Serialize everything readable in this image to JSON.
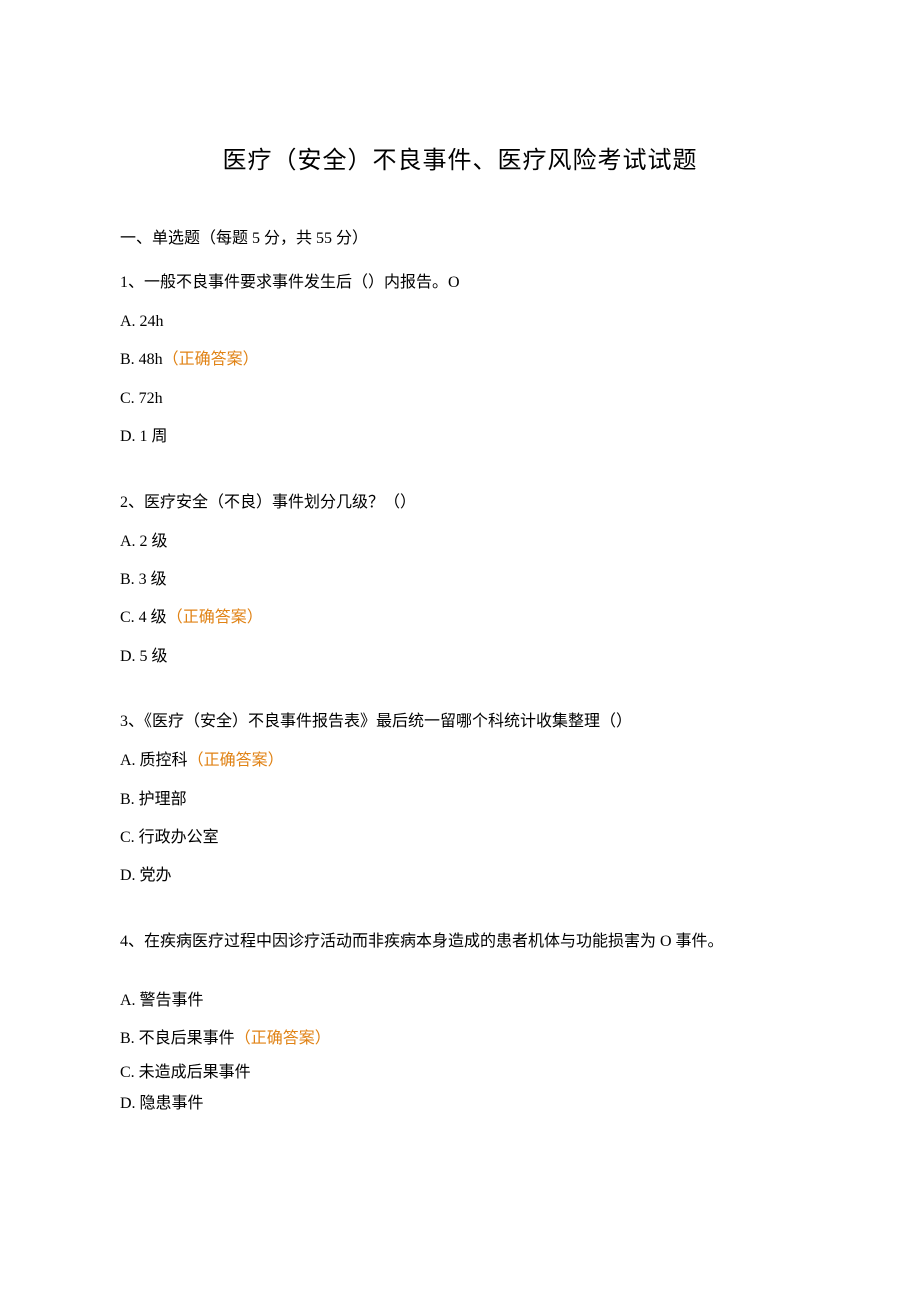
{
  "title": "医疗（安全）不良事件、医疗风险考试试题",
  "section_heading": "一、单选题（每题 5 分，共 55 分）",
  "answer_tag": "（正确答案）",
  "q1": {
    "stem": "1、一般不良事件要求事件发生后（）内报告。O",
    "a": "A. 24h",
    "b": "B. 48h",
    "c": "C. 72h",
    "d": "D. 1 周"
  },
  "q2": {
    "stem": "2、医疗安全（不良）事件划分几级？（）",
    "a": "A. 2 级",
    "b": "B. 3 级",
    "c": "C. 4 级",
    "d": "D. 5 级"
  },
  "q3": {
    "stem": "3、《医疗（安全）不良事件报告表》最后统一留哪个科统计收集整理（）",
    "a": "A. 质控科",
    "b": "B. 护理部",
    "c": "C. 行政办公室",
    "d": "D. 党办"
  },
  "q4": {
    "stem": "4、在疾病医疗过程中因诊疗活动而非疾病本身造成的患者机体与功能损害为 O 事件。",
    "a": "A. 警告事件",
    "b": "B. 不良后果事件",
    "c": "C. 未造成后果事件",
    "d": "D. 隐患事件"
  }
}
